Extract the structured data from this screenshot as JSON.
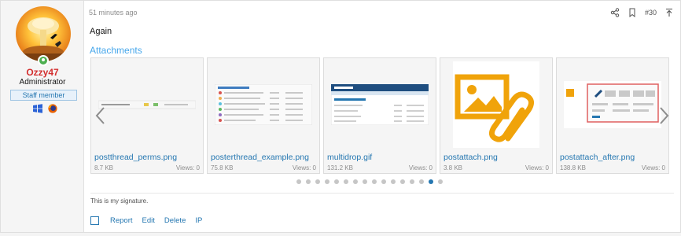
{
  "user": {
    "name": "Ozzy47",
    "title": "Administrator",
    "badge": "Staff member",
    "name_color": "#d32f2f"
  },
  "post": {
    "time": "51 minutes ago",
    "number": "#30",
    "body": "Again",
    "attachments_title": "Attachments"
  },
  "attachments": [
    {
      "name": "postthread_perms.png",
      "size": "8.7 KB",
      "views": "Views: 0"
    },
    {
      "name": "posterthread_example.png",
      "size": "75.8 KB",
      "views": "Views: 0"
    },
    {
      "name": "multidrop.gif",
      "size": "131.2 KB",
      "views": "Views: 0"
    },
    {
      "name": "postattach.png",
      "size": "3.8 KB",
      "views": "Views: 0"
    },
    {
      "name": "postattach_after.png",
      "size": "138.8 KB",
      "views": "Views: 0"
    }
  ],
  "pager": {
    "total": 16,
    "active_index": 14
  },
  "signature": "This is my signature.",
  "footer": {
    "report": "Report",
    "edit": "Edit",
    "delete": "Delete",
    "ip": "IP"
  },
  "colors": {
    "link": "#2577b1",
    "accent": "#47a7eb",
    "attach_icon": "#f0a30a"
  }
}
